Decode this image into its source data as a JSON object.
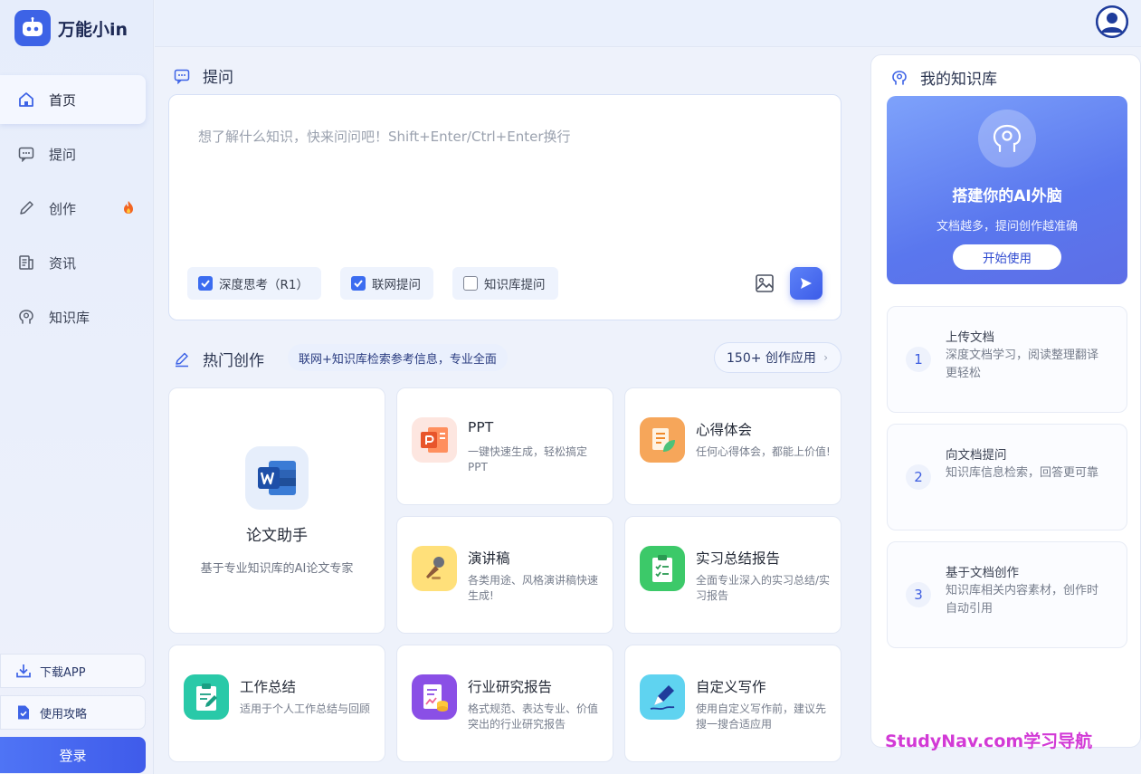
{
  "brand": {
    "name": "万能小in"
  },
  "nav": {
    "items": [
      {
        "label": "首页",
        "icon": "home-icon"
      },
      {
        "label": "提问",
        "icon": "chat-icon"
      },
      {
        "label": "创作",
        "icon": "pencil-icon"
      },
      {
        "label": "资讯",
        "icon": "news-icon"
      },
      {
        "label": "知识库",
        "icon": "brain-icon"
      }
    ],
    "active": "首页"
  },
  "sidebar_bottom": {
    "download": "下载APP",
    "guide": "使用攻略",
    "login": "登录"
  },
  "ask": {
    "title": "提问",
    "placeholder": "想了解什么知识，快来问问吧！Shift+Enter/Ctrl+Enter换行",
    "options": [
      {
        "label": "深度思考（R1）",
        "checked": true
      },
      {
        "label": "联网提问",
        "checked": true
      },
      {
        "label": "知识库提问",
        "checked": false
      }
    ]
  },
  "hot": {
    "title": "热门创作",
    "desc": "联网+知识库检索参考信息，专业全面",
    "apps_button": "150+ 创作应用",
    "featured": {
      "title": "论文助手",
      "desc": "基于专业知识库的AI论文专家"
    },
    "cards": [
      {
        "title": "PPT",
        "desc": "一键快速生成，轻松搞定PPT"
      },
      {
        "title": "心得体会",
        "desc": "任何心得体会，都能上价值!"
      },
      {
        "title": "演讲稿",
        "desc": "各类用途、风格演讲稿快速生成!"
      },
      {
        "title": "实习总结报告",
        "desc": "全面专业深入的实习总结/实习报告"
      },
      {
        "title": "工作总结",
        "desc": "适用于个人工作总结与回顾"
      },
      {
        "title": "行业研究报告",
        "desc": "格式规范、表达专业、价值突出的行业研究报告"
      },
      {
        "title": "自定义写作",
        "desc": "使用自定义写作前，建议先搜一搜合适应用"
      }
    ]
  },
  "knowledge": {
    "title": "我的知识库",
    "hero_title": "搭建你的AI外脑",
    "hero_sub": "文档越多，提问创作越准确",
    "hero_button": "开始使用",
    "steps": [
      {
        "num": "1",
        "title": "上传文档",
        "desc": "深度文档学习，阅读整理翻译更轻松"
      },
      {
        "num": "2",
        "title": "向文档提问",
        "desc": "知识库信息检索，回答更可靠"
      },
      {
        "num": "3",
        "title": "基于文档创作",
        "desc": "知识库相关内容素材，创作时自动引用"
      }
    ]
  },
  "watermark": "StudyNav.com学习导航",
  "colors": {
    "accent": "#3d63e6",
    "watermark": "#d23ad6"
  }
}
